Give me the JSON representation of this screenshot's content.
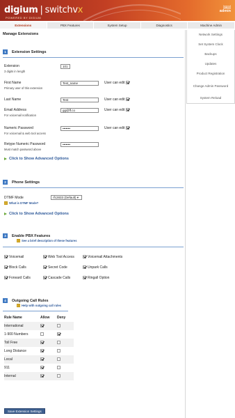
{
  "header": {
    "brand_left": "digium",
    "brand_sep": "|",
    "brand_right_a": "switchv",
    "brand_right_x": "x",
    "tagline": "POWERED BY DIGIUM",
    "logout_label": "logout",
    "user_label": "admin"
  },
  "nav": {
    "tabs": [
      "Extensions",
      "PBX Features",
      "System Setup",
      "Diagnostics",
      "Machine Admin"
    ],
    "active": "Extensions"
  },
  "sidebar": {
    "items": [
      "Network Settings",
      "Set System Clock",
      "Backups",
      "Updates",
      "Product Registration",
      "Change Admin Password",
      "System Reload"
    ]
  },
  "page": {
    "title": "Manage Extensions"
  },
  "ext_settings": {
    "number": "1",
    "title": "Extension Settings",
    "extension_label": "Extension",
    "extension_value": "101",
    "extension_hint": "3 digits in length",
    "first_name_label": "First Name",
    "first_name_value": "Test_name",
    "first_name_hint": "Primary user of this extension",
    "last_name_label": "Last Name",
    "last_name_value": "Test",
    "email_label": "Email Address",
    "email_value": "gg@ff.co",
    "email_hint": "For voicemail notification",
    "numeric_pw_label": "Numeric Password",
    "numeric_pw_value": "•••••••",
    "numeric_pw_hint": "For voicemail & web tool access",
    "retype_label": "Retype Numeric Password",
    "retype_value": "•••••••",
    "retype_hint": "Must match password above",
    "user_can_edit": "User can edit",
    "advanced_link": "Click to Show Advanced Options"
  },
  "phone_settings": {
    "number": "2",
    "title": "Phone Settings",
    "dtmf_label": "DTMF Mode",
    "dtmf_value": "rfc2833 (Default) ▾",
    "dtmf_help": "What is DTMF Mode?",
    "advanced_link": "Click to Show Advanced Options"
  },
  "pbx_features": {
    "number": "3",
    "title": "Enable PBX Features",
    "help": "See a brief description of these features",
    "features": [
      "Voicemail",
      "Web Tool Access",
      "Voicemail Attachments",
      "Block Calls",
      "Secret Code",
      "Unpark Calls",
      "Forward Calls",
      "Cascade Calls",
      "Ringall Option"
    ],
    "checked": [
      true,
      true,
      true,
      true,
      true,
      true,
      true,
      true,
      true
    ]
  },
  "outgoing": {
    "number": "4",
    "title": "Outgoing Call Rules",
    "help": "Help with outgoing call rules",
    "headers": [
      "Rule Name",
      "Allow",
      "Deny"
    ],
    "rows": [
      {
        "name": "International",
        "allow": true,
        "deny": false
      },
      {
        "name": "1-900 Numbers",
        "allow": false,
        "deny": true
      },
      {
        "name": "Toll Free",
        "allow": true,
        "deny": false
      },
      {
        "name": "Long Distance",
        "allow": true,
        "deny": false
      },
      {
        "name": "Local",
        "allow": true,
        "deny": false
      },
      {
        "name": "911",
        "allow": true,
        "deny": false
      },
      {
        "name": "Internal",
        "allow": true,
        "deny": false
      }
    ]
  },
  "save_label": "Save Extension Settings"
}
